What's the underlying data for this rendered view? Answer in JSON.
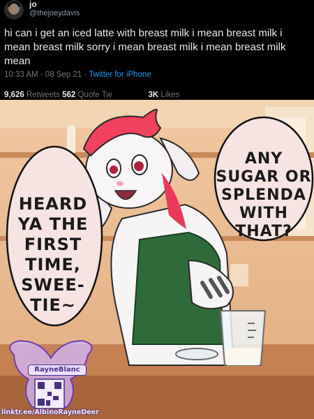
{
  "tweet": {
    "display_name": "jo",
    "handle": "@thejoeydavis",
    "text": "hi can i get an iced latte with breast milk i mean breast milk i mean breast milk sorry i mean breast milk i mean breast milk mean",
    "timestamp": "10:33 AM · 08 Sep 21 · ",
    "source": "Twitter for iPhone",
    "retweets_count": "9,626",
    "retweets_label": " Retweets   ",
    "quotes_count": "562",
    "quotes_label": " Quote Tw",
    "likes_count": "3K",
    "likes_label": " Likes"
  },
  "comic": {
    "bubble_left": [
      "HEARD",
      "YA THE",
      "FIRST",
      "TIME,",
      "SWEE-",
      "TIE~"
    ],
    "bubble_right": [
      "ANY",
      "SUGAR OR",
      "SPLENDA",
      "WITH",
      "THAT?"
    ],
    "artist_tag": "RayneBlanc",
    "link": "linktr.ee/AlbinoRayneDeer"
  },
  "colors": {
    "background": "#000000",
    "link_blue": "#1d9bf0",
    "muted": "#71767b",
    "hair_pink": "#f0415e",
    "apron_green": "#2f6b3a"
  }
}
